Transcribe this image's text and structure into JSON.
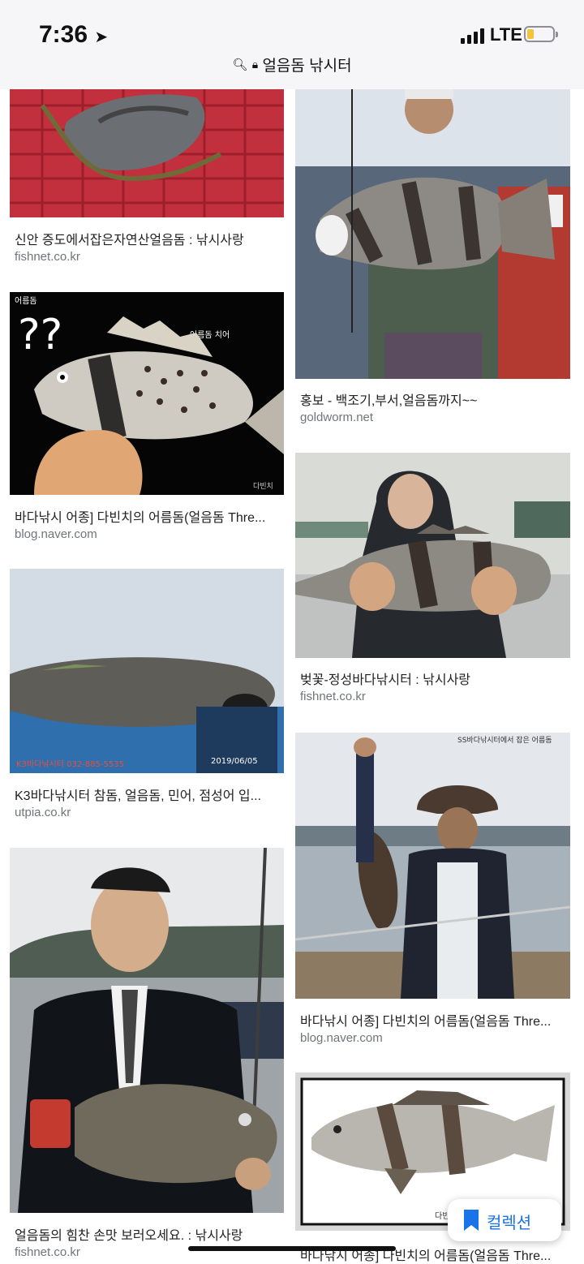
{
  "status": {
    "time": "7:36",
    "network": "LTE"
  },
  "address_bar": {
    "url_text": "얼음돔 낚시터"
  },
  "results": [
    {
      "caption": "신안 증도에서잡은자연산얼음돔 : 낚시사랑",
      "site": "fishnet.co.kr"
    },
    {
      "caption": "홍보 - 백조기,부서,얼음돔까지~~",
      "site": "goldworm.net"
    },
    {
      "caption": "바다낚시 어종] 다빈치의 어름돔(얼음돔 Thre...",
      "site": "blog.naver.com"
    },
    {
      "caption": "벚꽃-정성바다낚시터 : 낚시사랑",
      "site": "fishnet.co.kr"
    },
    {
      "caption": "K3바다낚시터 참돔, 얼음돔, 민어, 점성어 입...",
      "site": "utpia.co.kr"
    },
    {
      "caption": "바다낚시 어종] 다빈치의 어름돔(얼음돔 Thre...",
      "site": "blog.naver.com"
    },
    {
      "caption": "얼음돔의 힘찬 손맛 보러오세요. : 낚시사랑",
      "site": "fishnet.co.kr"
    },
    {
      "caption": "바다낚시 어종] 다빈치의 어름돔(얼음돔 Thre...",
      "site": ""
    }
  ],
  "image_text": {
    "question_marks": "??",
    "fish_name_corner": "어름돔",
    "fish_label": "어름돔 치어",
    "k3_watermark": "K3바다낚시터 032-885-5535",
    "k3_date": "2019/06/05",
    "ss_watermark": "SS바다낚시터에서 잡은 어름돔",
    "davinci": "다빈치"
  },
  "collection_button": {
    "label": "컬렉션"
  },
  "colors": {
    "link_blue": "#1a73e8",
    "site_gray": "#70757a",
    "battery": "#f5c33b"
  }
}
